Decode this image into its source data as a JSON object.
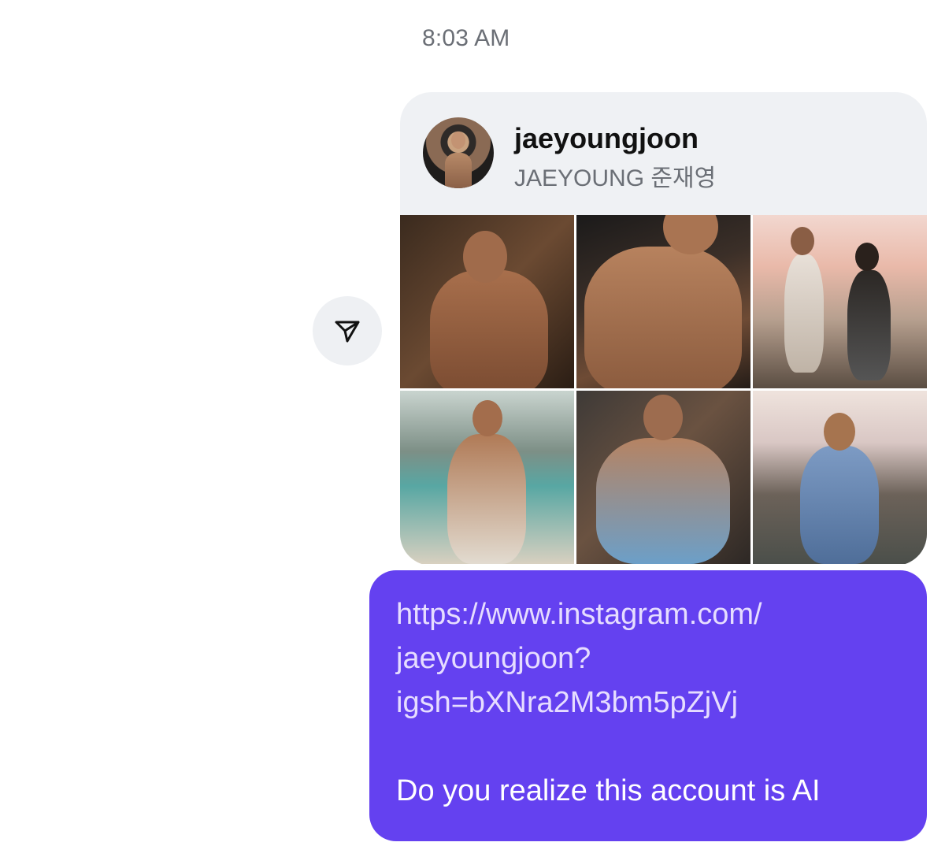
{
  "timestamp": "8:03 AM",
  "share_button": {
    "icon": "send-icon"
  },
  "profile_card": {
    "username": "jaeyoungjoon",
    "full_name": "JAEYOUNG 준재영",
    "avatar_icon": "avatar-photo",
    "photos": [
      {
        "name": "post-photo-1"
      },
      {
        "name": "post-photo-2"
      },
      {
        "name": "post-photo-3"
      },
      {
        "name": "post-photo-4"
      },
      {
        "name": "post-photo-5"
      },
      {
        "name": "post-photo-6"
      }
    ]
  },
  "message": {
    "link_line_1": "https://www.instagram.com/",
    "link_line_2": "jaeyoungjoon?",
    "link_line_3": "igsh=bXNra2M3bm5pZjVj",
    "text": "Do you realize this account is AI",
    "bubble_color": "#6441f0"
  }
}
